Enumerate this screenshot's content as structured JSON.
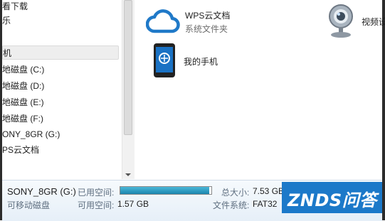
{
  "navigation": {
    "items": [
      {
        "label": "看下载",
        "selected": false
      },
      {
        "label": "乐",
        "selected": false
      },
      {
        "label": "机",
        "selected": true
      },
      {
        "label": "地磁盘 (C:)",
        "selected": false
      },
      {
        "label": "地磁盘 (D:)",
        "selected": false
      },
      {
        "label": "地磁盘 (E:)",
        "selected": false
      },
      {
        "label": "地磁盘 (F:)",
        "selected": false
      },
      {
        "label": "ONY_8GR (G:)",
        "selected": false
      },
      {
        "label": "PS云文档",
        "selected": false
      }
    ]
  },
  "content": {
    "tiles": [
      {
        "name": "WPS云文档",
        "subtitle": "系统文件夹",
        "icon": "cloud-icon"
      },
      {
        "name": "视频设",
        "subtitle": "",
        "icon": "webcam-icon"
      },
      {
        "name": "我的手机",
        "subtitle": "",
        "icon": "phone-icon"
      }
    ]
  },
  "details": {
    "drive_name": "SONY_8GR (G:)",
    "drive_type": "可移动磁盘",
    "used_label": "已用空间:",
    "used_fraction": 0.98,
    "free_label": "可用空间:",
    "free_value": "1.57 GB",
    "total_label": "总大小:",
    "total_value": "7.53 GB",
    "fs_label": "文件系统:",
    "fs_value": "FAT32"
  },
  "watermark": {
    "text": "ZNDS问答"
  },
  "colors": {
    "cloud": "#1f79c8",
    "usage_fill": "#1b85ad",
    "watermark_bg": "#1c79c9"
  }
}
